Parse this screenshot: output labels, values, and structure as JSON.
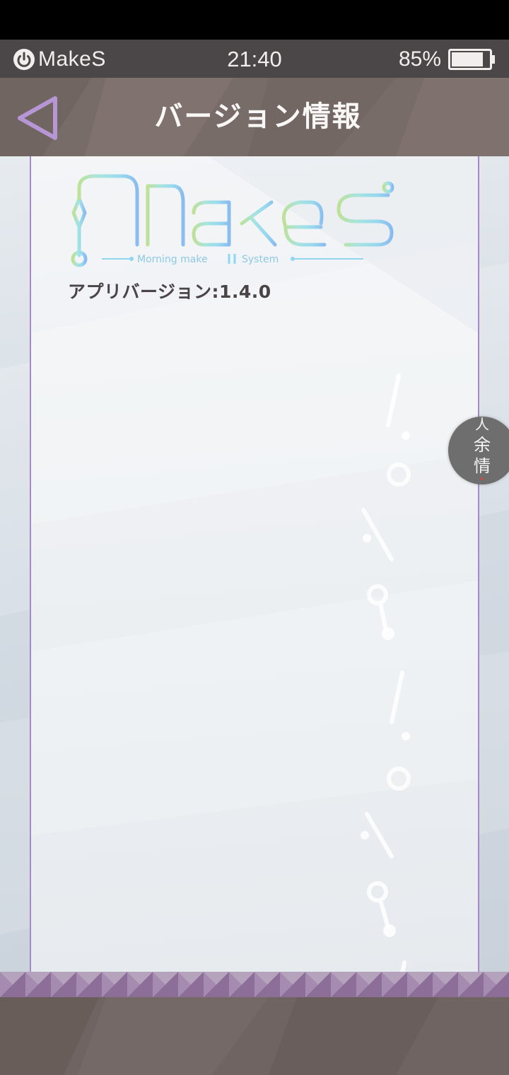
{
  "status_bar": {
    "app_name": "MakeS",
    "time": "21:40",
    "battery_percent": "85%",
    "battery_level": 0.85
  },
  "header": {
    "title": "バージョン情報",
    "back_icon": "back-triangle-icon"
  },
  "logo": {
    "wordmark": "MakeS",
    "tagline_left": "Morning make",
    "tagline_right": "System"
  },
  "content": {
    "version_text": "アプリバージョン:1.4.0"
  },
  "floating_badge": {
    "icon": "calligraphy-badge-icon",
    "text": "人余情"
  },
  "colors": {
    "status_bar": "#4b4647",
    "header": "#786c69",
    "panel_border": "#a889c5",
    "back_icon": "#b796d6",
    "footer": "#6f6461"
  }
}
